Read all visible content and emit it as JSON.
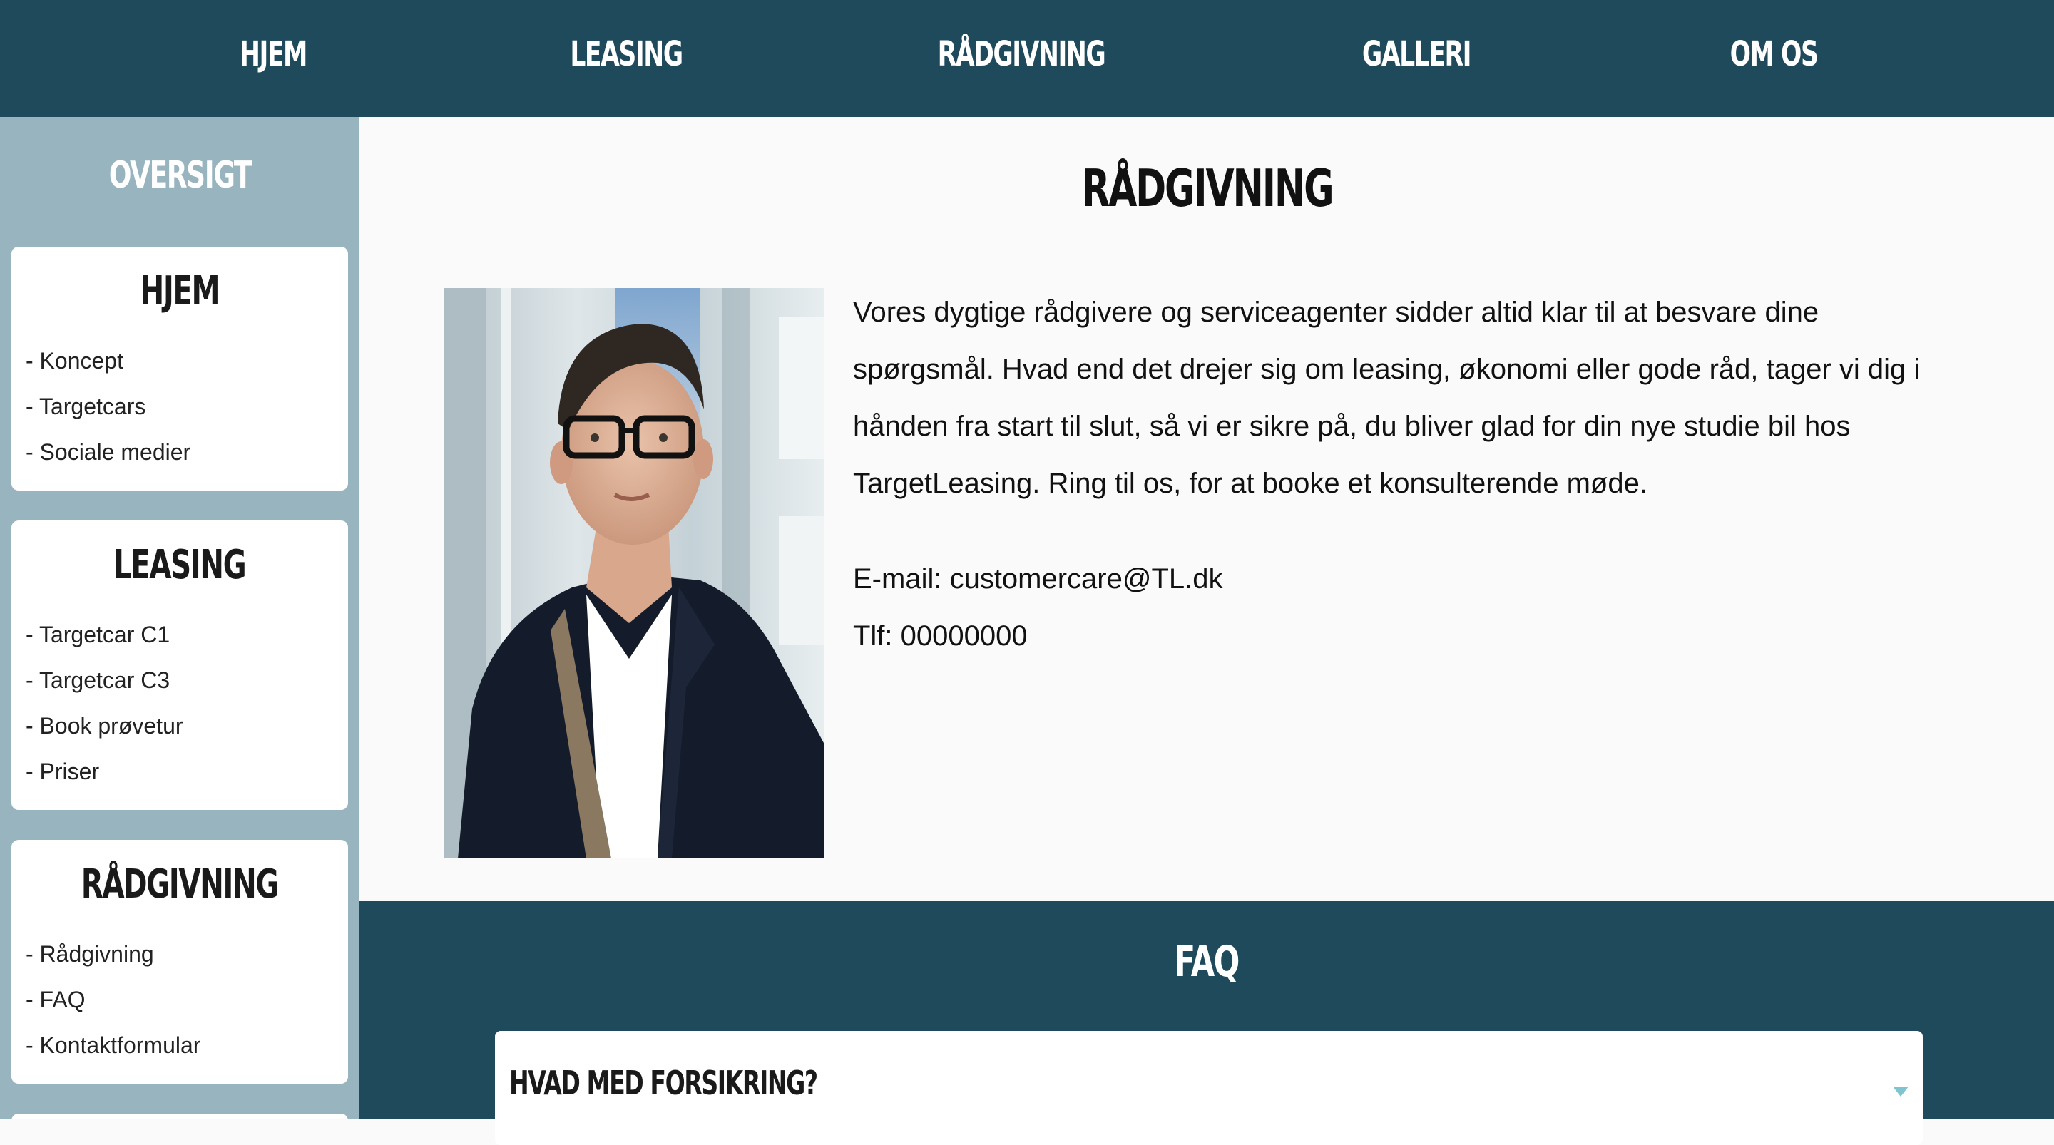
{
  "nav": {
    "items": [
      {
        "label": "HJEM"
      },
      {
        "label": "LEASING"
      },
      {
        "label": "RÅDGIVNING"
      },
      {
        "label": "GALLERI"
      },
      {
        "label": "OM OS"
      }
    ]
  },
  "sidebar": {
    "title": "OVERSIGT",
    "sections": [
      {
        "title": "HJEM",
        "links": [
          "- Koncept",
          "- Targetcars",
          "- Sociale medier"
        ]
      },
      {
        "title": "LEASING",
        "links": [
          "- Targetcar C1",
          "- Targetcar C3",
          "- Book prøvetur",
          "- Priser"
        ]
      },
      {
        "title": "RÅDGIVNING",
        "links": [
          "- Rådgivning",
          "- FAQ",
          "- Kontaktformular"
        ]
      }
    ]
  },
  "main": {
    "title": "RÅDGIVNING",
    "intro": "Vores dygtige rådgivere og serviceagenter sidder altid klar til at besvare dine spørgsmål. Hvad end det drejer sig om leasing, økonomi eller gode råd, tager vi dig i hånden fra start til slut, så vi er sikre på, du bliver glad for din nye studie bil hos TargetLeasing. Ring til os, for at booke et konsulterende møde.",
    "email": "E-mail: customercare@TL.dk",
    "phone": "Tlf: 00000000"
  },
  "faq": {
    "title": "FAQ",
    "items": [
      {
        "question": "HVAD MED FORSIKRING?"
      }
    ]
  },
  "colors": {
    "primary": "#1e4a5b",
    "sidebar": "#98b4bf",
    "caret": "#7fc4cf"
  }
}
